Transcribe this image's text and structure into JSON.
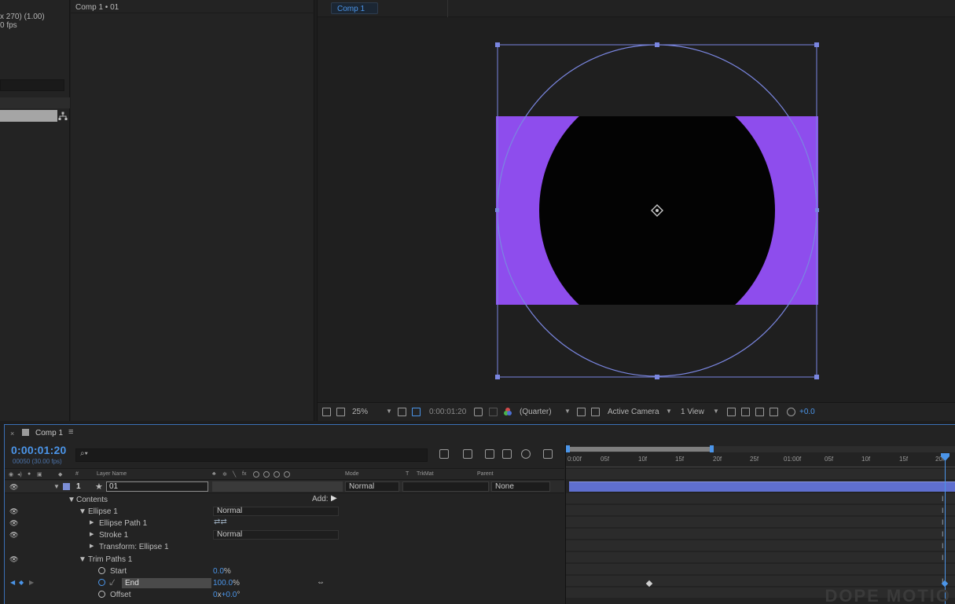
{
  "project": {
    "info_line1": "x 270) (1.00)",
    "info_line2": "0 fps"
  },
  "effect_controls": {
    "tab_label": "Comp 1 • 01"
  },
  "viewer": {
    "tab_label": "Comp 1",
    "toolbar": {
      "zoom": "25%",
      "timecode": "0:00:01:20",
      "resolution": "(Quarter)",
      "camera": "Active Camera",
      "views": "1 View",
      "exposure": "+0.0"
    },
    "colors": {
      "fill": "#8e4ded",
      "mask": "#030303",
      "handles": "#7a86e0",
      "bg": "#1f1f1f"
    }
  },
  "timeline": {
    "tab_label": "Comp 1",
    "timecode": "0:00:01:20",
    "frame_info": "00050 (30.00 fps)",
    "columns": {
      "hash": "#",
      "layer_name": "Layer Name",
      "mode": "Mode",
      "t": "T",
      "trkmat": "TrkMat",
      "parent": "Parent"
    },
    "layer": {
      "number": "1",
      "name": "01",
      "mode": "Normal",
      "parent": "None"
    },
    "props": {
      "contents": "Contents",
      "add_label": "Add:",
      "ellipse1": "Ellipse 1",
      "ellipse1_mode": "Normal",
      "ellipse_path": "Ellipse Path 1",
      "stroke": "Stroke 1",
      "stroke_mode": "Normal",
      "transform": "Transform: Ellipse 1",
      "trim_paths": "Trim Paths 1",
      "start_label": "Start",
      "start_value": "0.0",
      "start_unit": "%",
      "end_label": "End",
      "end_value": "100.0",
      "end_unit": "%",
      "offset_label": "Offset",
      "offset_value_a": "0",
      "offset_x": "x",
      "offset_value_b": "+0.0",
      "offset_unit": "°"
    },
    "ruler_ticks": [
      "0:00f",
      "05f",
      "10f",
      "15f",
      "20f",
      "25f",
      "01:00f",
      "05f",
      "10f",
      "15f",
      "20f"
    ],
    "watermark": "DOPE MOTIO"
  }
}
